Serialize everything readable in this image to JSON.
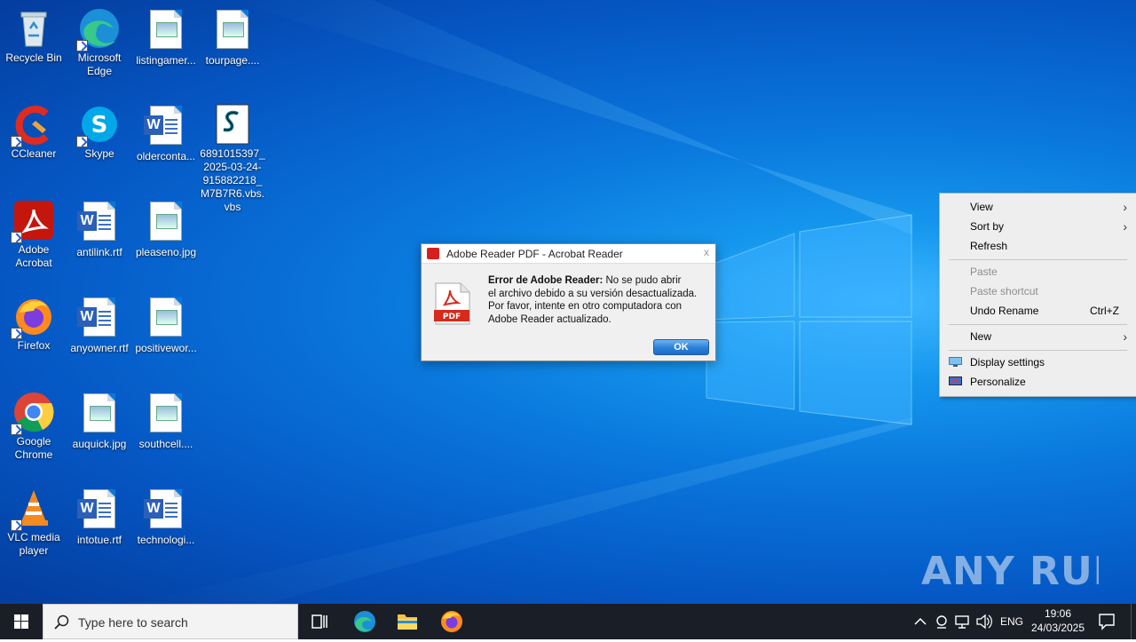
{
  "desktop_icons": [
    {
      "label": "Recycle Bin"
    },
    {
      "label": "Microsoft Edge"
    },
    {
      "label": "listingamer..."
    },
    {
      "label": "tourpage...."
    },
    {
      "label": "CCleaner"
    },
    {
      "label": "Skype"
    },
    {
      "label": "olderconta..."
    },
    {
      "label": "6891015397_2025-03-24-915882218_M7B7R6.vbs.vbs"
    },
    {
      "label": "Adobe Acrobat"
    },
    {
      "label": "antilink.rtf"
    },
    {
      "label": "pleaseno.jpg"
    },
    {
      "label": "Firefox"
    },
    {
      "label": "anyowner.rtf"
    },
    {
      "label": "positivewor..."
    },
    {
      "label": "Google Chrome"
    },
    {
      "label": "auquick.jpg"
    },
    {
      "label": "southcell...."
    },
    {
      "label": "VLC media player"
    },
    {
      "label": "intotue.rtf"
    },
    {
      "label": "technologi..."
    }
  ],
  "dialog": {
    "title": "Adobe Reader PDF - Acrobat Reader",
    "close": "x",
    "icon_label": "PDF",
    "message_bold": "Error de Adobe Reader:",
    "message_line1": " No se pudo abrir",
    "message_line2": "el archivo debido a su versión desactualizada.",
    "message_line3": "Por favor, intente en otro computadora con",
    "message_line4": "Adobe Reader actualizado.",
    "ok": "OK"
  },
  "context_menu": {
    "view": "View",
    "sort_by": "Sort by",
    "refresh": "Refresh",
    "paste": "Paste",
    "paste_shortcut": "Paste shortcut",
    "undo_rename": "Undo Rename",
    "undo_shortcut": "Ctrl+Z",
    "new": "New",
    "display_settings": "Display settings",
    "personalize": "Personalize"
  },
  "taskbar": {
    "search_placeholder": "Type here to search",
    "language": "ENG",
    "time": "19:06",
    "date": "24/03/2025"
  },
  "watermark": "ANY RUN"
}
